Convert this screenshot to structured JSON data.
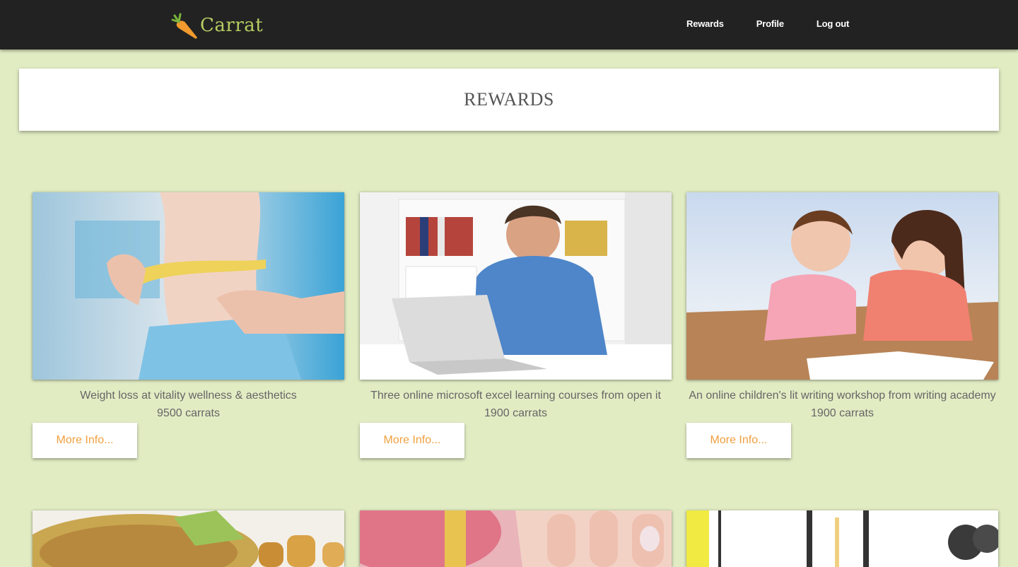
{
  "nav": {
    "brand": "Carrat",
    "links": [
      "Rewards",
      "Profile",
      "Log out"
    ]
  },
  "page": {
    "title": "REWARDS"
  },
  "rewards": [
    {
      "title": "Weight loss at vitality wellness & aesthetics",
      "cost": "9500 carrats",
      "button": "More Info..."
    },
    {
      "title": "Three online microsoft excel learning courses from open it",
      "cost": "1900 carrats",
      "button": "More Info..."
    },
    {
      "title": "An online children's lit writing workshop from writing academy",
      "cost": "1900 carrats",
      "button": "More Info..."
    }
  ],
  "colors": {
    "background": "#e1ecc3",
    "topbar": "#222222",
    "brand": "#b7cd62",
    "button_text": "#f0a040"
  }
}
